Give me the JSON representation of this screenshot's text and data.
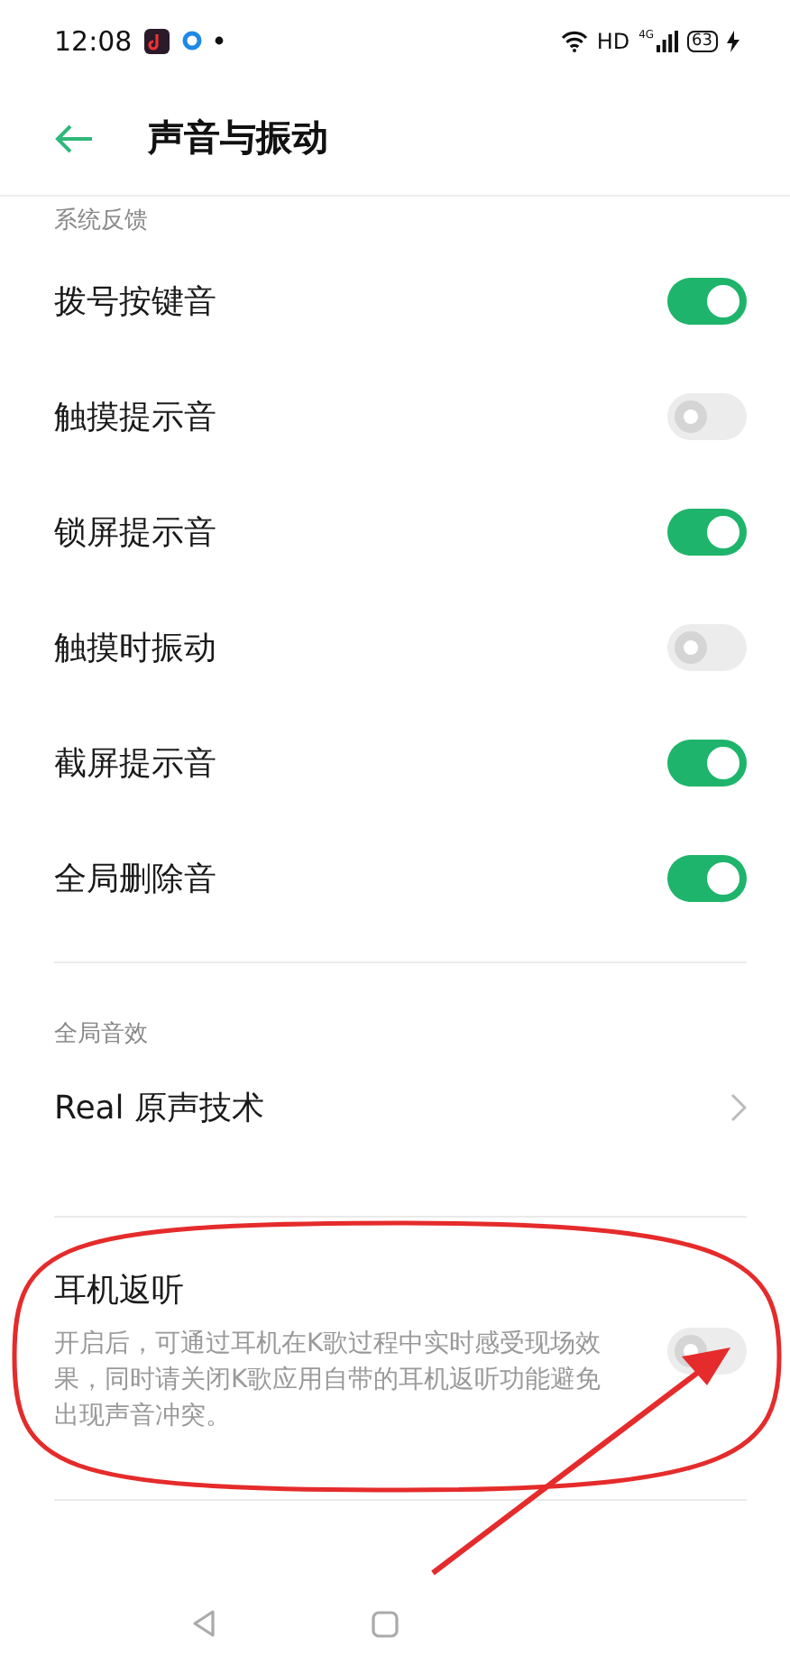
{
  "status_bar": {
    "time": "12:08",
    "network": "HD",
    "signal_label": "4G",
    "battery": "63",
    "charging": true
  },
  "header": {
    "title": "声音与振动"
  },
  "sections": [
    {
      "title": "系统反馈",
      "items": [
        {
          "kind": "toggle",
          "label": "拨号按键音",
          "on": true
        },
        {
          "kind": "toggle",
          "label": "触摸提示音",
          "on": false
        },
        {
          "kind": "toggle",
          "label": "锁屏提示音",
          "on": true
        },
        {
          "kind": "toggle",
          "label": "触摸时振动",
          "on": false
        },
        {
          "kind": "toggle",
          "label": "截屏提示音",
          "on": true
        },
        {
          "kind": "toggle",
          "label": "全局删除音",
          "on": true
        }
      ]
    },
    {
      "title": "全局音效",
      "items": [
        {
          "kind": "link",
          "label": "Real 原声技术"
        }
      ]
    },
    {
      "items": [
        {
          "kind": "toggle",
          "label": "耳机返听",
          "description": "开启后，可通过耳机在K歌过程中实时感受现场效果，同时请关闭K歌应用自带的耳机返听功能避免出现声音冲突。",
          "on": false
        }
      ]
    }
  ],
  "nav_bar": {
    "buttons": [
      {
        "kind": "back"
      },
      {
        "kind": "home"
      }
    ]
  }
}
